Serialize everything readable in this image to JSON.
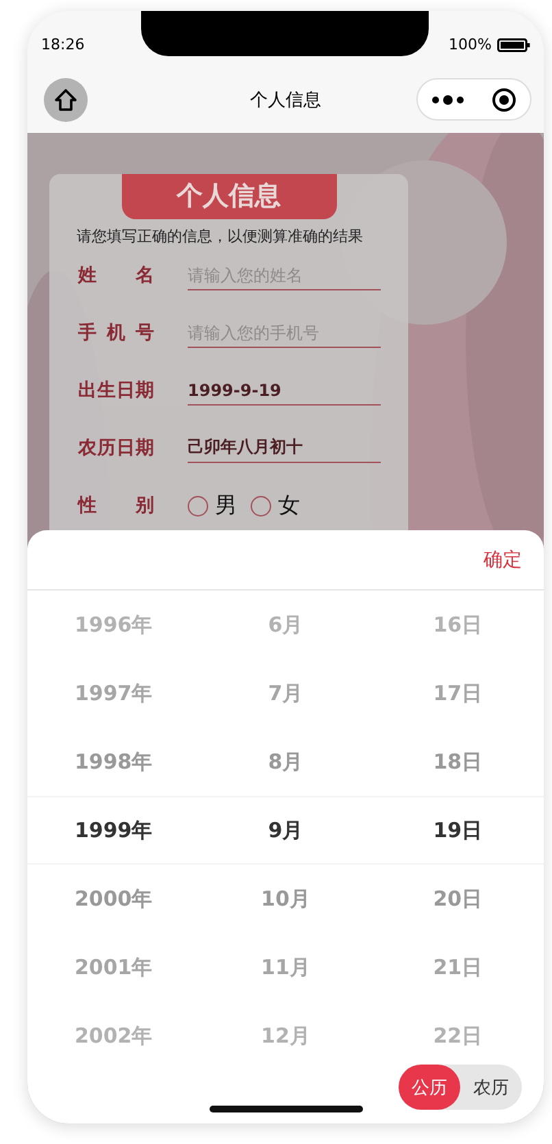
{
  "status_bar": {
    "time": "18:26",
    "battery": "100%"
  },
  "nav": {
    "title": "个人信息"
  },
  "card": {
    "title": "个人信息",
    "note": "请您填写正确的信息，以便测算准确的结果",
    "fields": [
      {
        "kind": "input",
        "label": "姓 名",
        "placeholder": "请输入您的姓名"
      },
      {
        "kind": "input",
        "label": "手 机 号",
        "placeholder": "请输入您的手机号"
      },
      {
        "kind": "value",
        "label": "出生日期",
        "value": "1999-9-19"
      },
      {
        "kind": "value",
        "label": "农历日期",
        "value": "己卯年八月初十"
      },
      {
        "kind": "radio",
        "label": "性 别",
        "options": [
          {
            "label": "男",
            "checked": false
          },
          {
            "label": "女",
            "checked": false
          }
        ]
      }
    ]
  },
  "picker": {
    "confirm": "确定",
    "columns": [
      {
        "items": [
          {
            "label": "1996年",
            "selected": false
          },
          {
            "label": "1997年",
            "selected": false
          },
          {
            "label": "1998年",
            "selected": false
          },
          {
            "label": "1999年",
            "selected": true
          },
          {
            "label": "2000年",
            "selected": false
          },
          {
            "label": "2001年",
            "selected": false
          },
          {
            "label": "2002年",
            "selected": false
          }
        ]
      },
      {
        "items": [
          {
            "label": "6月",
            "selected": false
          },
          {
            "label": "7月",
            "selected": false
          },
          {
            "label": "8月",
            "selected": false
          },
          {
            "label": "9月",
            "selected": true
          },
          {
            "label": "10月",
            "selected": false
          },
          {
            "label": "11月",
            "selected": false
          },
          {
            "label": "12月",
            "selected": false
          }
        ]
      },
      {
        "items": [
          {
            "label": "16日",
            "selected": false
          },
          {
            "label": "17日",
            "selected": false
          },
          {
            "label": "18日",
            "selected": false
          },
          {
            "label": "19日",
            "selected": true
          },
          {
            "label": "20日",
            "selected": false
          },
          {
            "label": "21日",
            "selected": false
          },
          {
            "label": "22日",
            "selected": false
          }
        ]
      }
    ],
    "calendar": [
      {
        "label": "公历",
        "selected": true
      },
      {
        "label": "农历",
        "selected": false
      }
    ]
  }
}
